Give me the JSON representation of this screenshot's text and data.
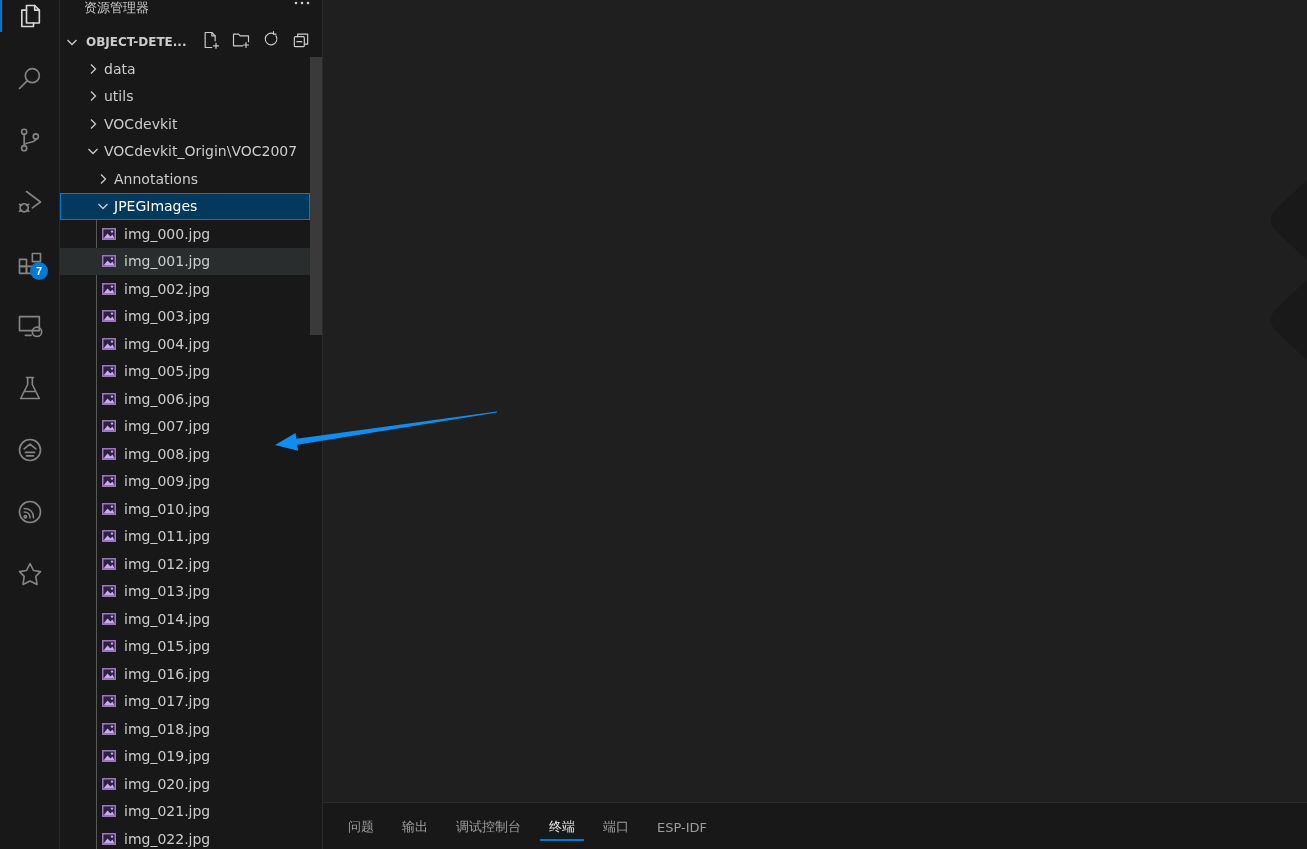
{
  "activity_bar": [
    {
      "kind": "explorer",
      "selected": true
    },
    {
      "kind": "search",
      "selected": false
    },
    {
      "kind": "source-control",
      "selected": false
    },
    {
      "kind": "run-debug",
      "selected": false
    },
    {
      "kind": "extensions",
      "selected": false,
      "badge": "7"
    },
    {
      "kind": "remote",
      "selected": false
    },
    {
      "kind": "testing",
      "selected": false
    },
    {
      "kind": "seal",
      "selected": false
    },
    {
      "kind": "wifi",
      "selected": false
    },
    {
      "kind": "star",
      "selected": false
    }
  ],
  "sidebar": {
    "title": "资源管理器",
    "root": {
      "label": "OBJECT-DETE...",
      "expanded": true,
      "children": [
        {
          "kind": "folder",
          "label": "data",
          "expanded": false,
          "selected": false,
          "hovered": false
        },
        {
          "kind": "folder",
          "label": "utils",
          "expanded": false,
          "selected": false,
          "hovered": false
        },
        {
          "kind": "folder",
          "label": "VOCdevkit",
          "expanded": false,
          "selected": false,
          "hovered": false
        },
        {
          "kind": "folder",
          "label": "VOCdevkit_Origin\\VOC2007",
          "expanded": true,
          "selected": false,
          "hovered": false,
          "children": [
            {
              "kind": "folder",
              "label": "Annotations",
              "expanded": false,
              "selected": false,
              "hovered": false
            },
            {
              "kind": "folder",
              "label": "JPEGImages",
              "expanded": true,
              "selected": true,
              "hovered": false,
              "children": [
                {
                  "kind": "image",
                  "label": "img_000.jpg",
                  "selected": false,
                  "hovered": false
                },
                {
                  "kind": "image",
                  "label": "img_001.jpg",
                  "selected": false,
                  "hovered": true
                },
                {
                  "kind": "image",
                  "label": "img_002.jpg",
                  "selected": false,
                  "hovered": false
                },
                {
                  "kind": "image",
                  "label": "img_003.jpg",
                  "selected": false,
                  "hovered": false
                },
                {
                  "kind": "image",
                  "label": "img_004.jpg",
                  "selected": false,
                  "hovered": false
                },
                {
                  "kind": "image",
                  "label": "img_005.jpg",
                  "selected": false,
                  "hovered": false
                },
                {
                  "kind": "image",
                  "label": "img_006.jpg",
                  "selected": false,
                  "hovered": false
                },
                {
                  "kind": "image",
                  "label": "img_007.jpg",
                  "selected": false,
                  "hovered": false
                },
                {
                  "kind": "image",
                  "label": "img_008.jpg",
                  "selected": false,
                  "hovered": false
                },
                {
                  "kind": "image",
                  "label": "img_009.jpg",
                  "selected": false,
                  "hovered": false
                },
                {
                  "kind": "image",
                  "label": "img_010.jpg",
                  "selected": false,
                  "hovered": false
                },
                {
                  "kind": "image",
                  "label": "img_011.jpg",
                  "selected": false,
                  "hovered": false
                },
                {
                  "kind": "image",
                  "label": "img_012.jpg",
                  "selected": false,
                  "hovered": false
                },
                {
                  "kind": "image",
                  "label": "img_013.jpg",
                  "selected": false,
                  "hovered": false
                },
                {
                  "kind": "image",
                  "label": "img_014.jpg",
                  "selected": false,
                  "hovered": false
                },
                {
                  "kind": "image",
                  "label": "img_015.jpg",
                  "selected": false,
                  "hovered": false
                },
                {
                  "kind": "image",
                  "label": "img_016.jpg",
                  "selected": false,
                  "hovered": false
                },
                {
                  "kind": "image",
                  "label": "img_017.jpg",
                  "selected": false,
                  "hovered": false
                },
                {
                  "kind": "image",
                  "label": "img_018.jpg",
                  "selected": false,
                  "hovered": false
                },
                {
                  "kind": "image",
                  "label": "img_019.jpg",
                  "selected": false,
                  "hovered": false
                },
                {
                  "kind": "image",
                  "label": "img_020.jpg",
                  "selected": false,
                  "hovered": false
                },
                {
                  "kind": "image",
                  "label": "img_021.jpg",
                  "selected": false,
                  "hovered": false
                },
                {
                  "kind": "image",
                  "label": "img_022.jpg",
                  "selected": false,
                  "hovered": false
                }
              ]
            }
          ]
        }
      ]
    }
  },
  "panel": {
    "tabs": [
      {
        "label": "问题",
        "selected": false
      },
      {
        "label": "输出",
        "selected": false
      },
      {
        "label": "调试控制台",
        "selected": false
      },
      {
        "label": "终端",
        "selected": true
      },
      {
        "label": "端口",
        "selected": false
      },
      {
        "label": "ESP-IDF",
        "selected": false
      }
    ]
  }
}
